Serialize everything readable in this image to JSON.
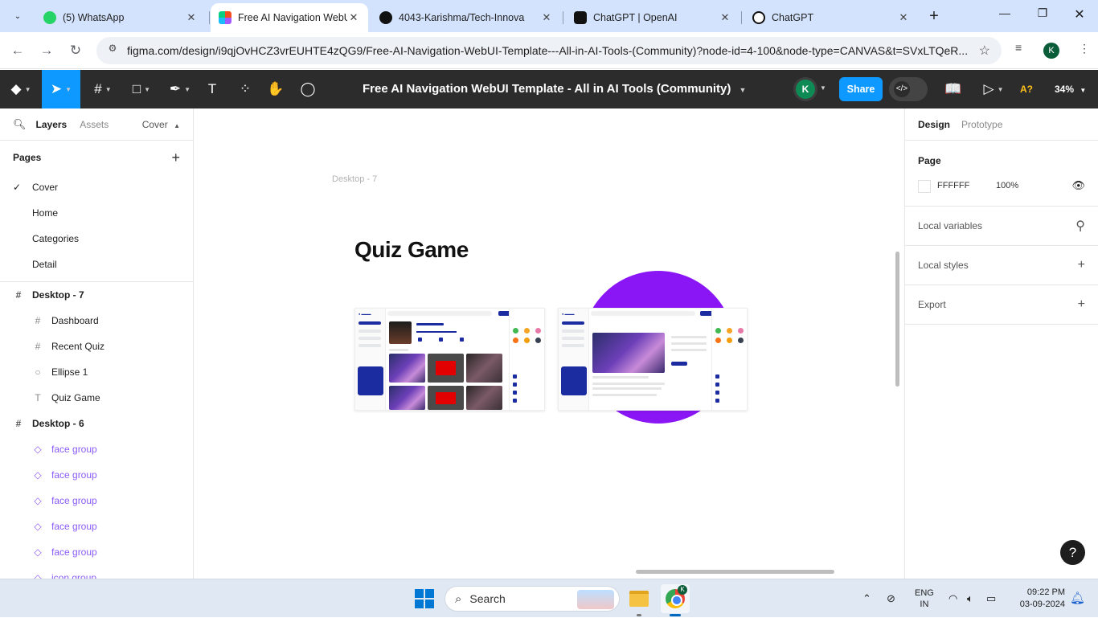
{
  "browser": {
    "tabs": [
      {
        "title": "(5) WhatsApp",
        "favicon": "whatsapp-icon",
        "color": "#25d366"
      },
      {
        "title": "Free AI Navigation WebUI Te",
        "favicon": "figma-icon",
        "color": "#f24e1e",
        "active": true
      },
      {
        "title": "4043-Karishma/Tech-Innova",
        "favicon": "github-icon",
        "color": "#111111"
      },
      {
        "title": "ChatGPT | OpenAI",
        "favicon": "openai-icon",
        "color": "#111111"
      },
      {
        "title": "ChatGPT",
        "favicon": "openai-icon",
        "color": "#111111"
      }
    ],
    "url": "figma.com/design/i9qjOvHCZ3vrEUHTE4zQG9/Free-AI-Navigation-WebUI-Template---All-in-AI-Tools-(Community)?node-id=4-100&node-type=CANVAS&t=SVxLTQeR...",
    "profile_initial": "K"
  },
  "figma": {
    "file_title": "Free AI Navigation WebUI Template - All in AI Tools (Community)",
    "avatar_initial": "K",
    "share_label": "Share",
    "zoom": "34%",
    "a_label": "A?",
    "accent": "#0d99ff"
  },
  "left_panel": {
    "tab_layers": "Layers",
    "tab_assets": "Assets",
    "page_selector": "Cover",
    "pages_title": "Pages",
    "pages": [
      "Cover",
      "Home",
      "Categories",
      "Detail"
    ],
    "selected_page": "Cover",
    "layers": [
      {
        "name": "Desktop - 7",
        "kind": "frame"
      },
      {
        "name": "Dashboard",
        "kind": "frame-child"
      },
      {
        "name": "Recent Quiz",
        "kind": "frame-child"
      },
      {
        "name": "Ellipse 1",
        "kind": "ellipse"
      },
      {
        "name": "Quiz Game",
        "kind": "text"
      },
      {
        "name": "Desktop - 6",
        "kind": "frame"
      },
      {
        "name": "face group",
        "kind": "component"
      },
      {
        "name": "face group",
        "kind": "component"
      },
      {
        "name": "face group",
        "kind": "component"
      },
      {
        "name": "face group",
        "kind": "component"
      },
      {
        "name": "face group",
        "kind": "component"
      },
      {
        "name": "icon group",
        "kind": "component"
      }
    ]
  },
  "canvas": {
    "frame_label": "Desktop - 7",
    "title": "Quiz Game",
    "ellipse_color": "#8a16f5"
  },
  "right_panel": {
    "tab_design": "Design",
    "tab_prototype": "Prototype",
    "page_title": "Page",
    "page_color": "FFFFFF",
    "page_opacity": "100%",
    "local_variables": "Local variables",
    "local_styles": "Local styles",
    "export": "Export"
  },
  "taskbar": {
    "search_label": "Search",
    "lang_line1": "ENG",
    "lang_line2": "IN",
    "time": "09:22 PM",
    "date": "03-09-2024",
    "chrome_badge": "K"
  }
}
